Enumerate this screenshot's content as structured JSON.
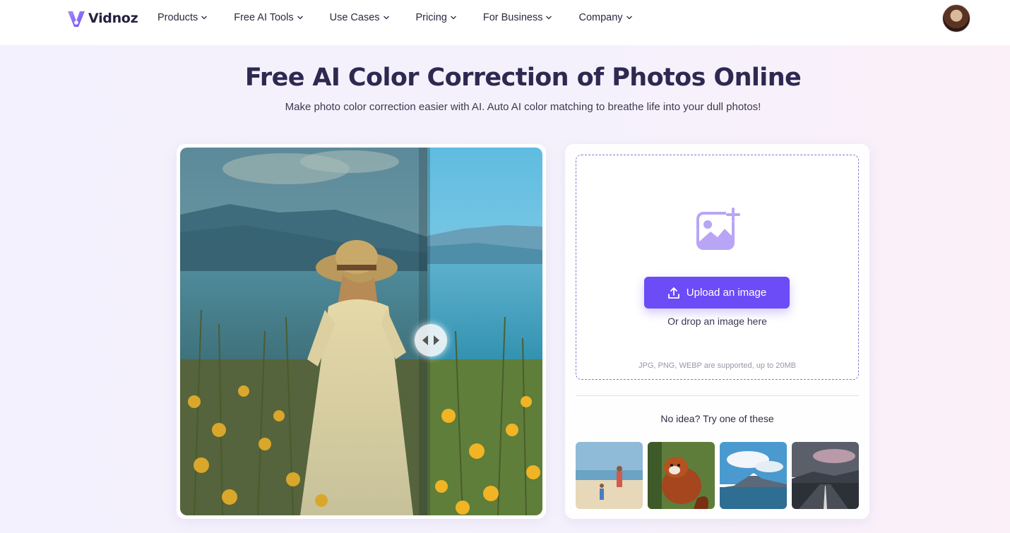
{
  "header": {
    "brand": "Vidnoz",
    "nav": [
      {
        "label": "Products"
      },
      {
        "label": "Free AI Tools"
      },
      {
        "label": "Use Cases"
      },
      {
        "label": "Pricing"
      },
      {
        "label": "For Business"
      },
      {
        "label": "Company"
      }
    ]
  },
  "hero": {
    "title": "Free AI Color Correction of Photos Online",
    "subtitle": "Make photo color correction easier with AI. Auto AI color matching to breathe life into your dull photos!"
  },
  "upload": {
    "button_label": "Upload an image",
    "drop_hint": "Or drop an image here",
    "formats_note": "JPG, PNG, WEBP are supported, up to 20MB",
    "try_label": "No idea? Try one of these"
  },
  "colors": {
    "accent": "#6b4cf6",
    "title": "#2d2951",
    "icon_purple": "#b9a5f5"
  },
  "icons": {
    "nav_chevron": "chevron-down-icon",
    "upload": "upload-icon",
    "add_image": "add-image-icon",
    "compare": "compare-arrows-icon"
  }
}
